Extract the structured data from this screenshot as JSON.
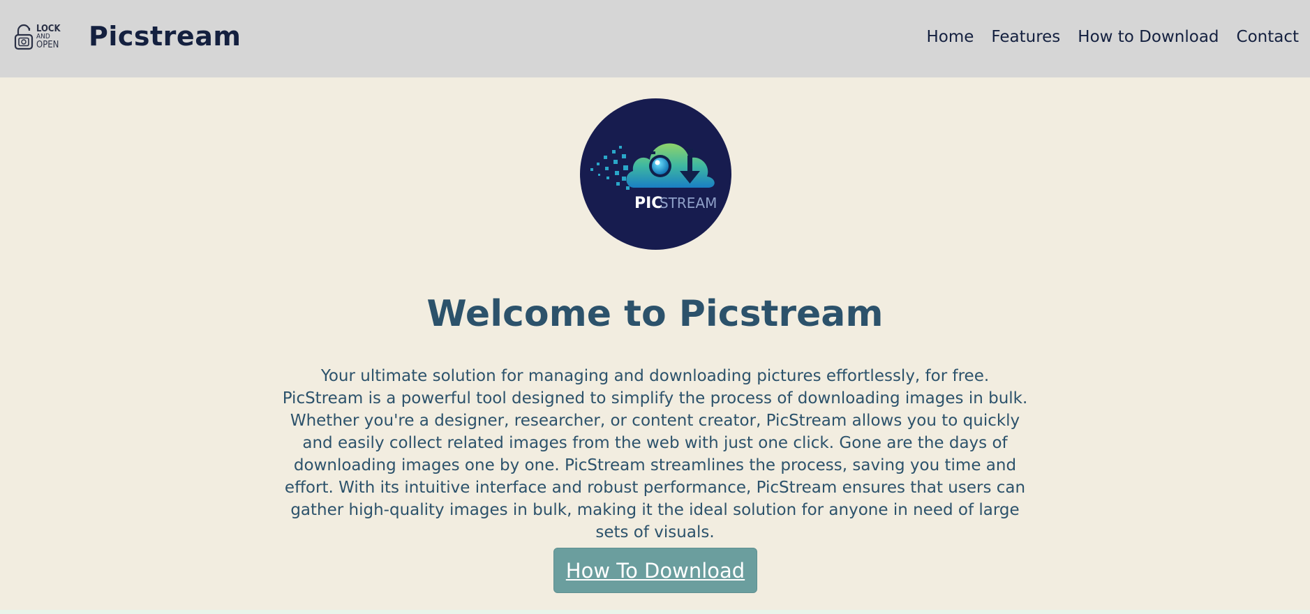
{
  "header": {
    "lock_logo": {
      "line1": "LOCK",
      "line2": "AND",
      "line3": "OPEN"
    },
    "brand": "Picstream",
    "nav": [
      {
        "label": "Home"
      },
      {
        "label": "Features"
      },
      {
        "label": "How to Download"
      },
      {
        "label": "Contact"
      }
    ]
  },
  "hero": {
    "logo": {
      "text_bold": "PIC",
      "text_light": "STREAM",
      "icon": "cloud-camera-download-icon"
    },
    "title": "Welcome to Picstream",
    "description": "Your ultimate solution for managing and downloading pictures effortlessly, for free. PicStream is a powerful tool designed to simplify the process of downloading images in bulk. Whether you're a designer, researcher, or content creator, PicStream allows you to quickly and easily collect related images from the web with just one click. Gone are the days of downloading images one by one. PicStream streamlines the process, saving you time and effort. With its intuitive interface and robust performance, PicStream ensures that users can gather high-quality images in bulk, making it the ideal solution for anyone in need of large sets of visuals.",
    "cta_label": "How To Download"
  },
  "colors": {
    "header_bg": "#d6d6d6",
    "page_bg": "#f2ede0",
    "brand_text": "#14203f",
    "heading": "#2c526b",
    "button_bg": "#6b9e9e",
    "logo_bg": "#171c4f"
  }
}
